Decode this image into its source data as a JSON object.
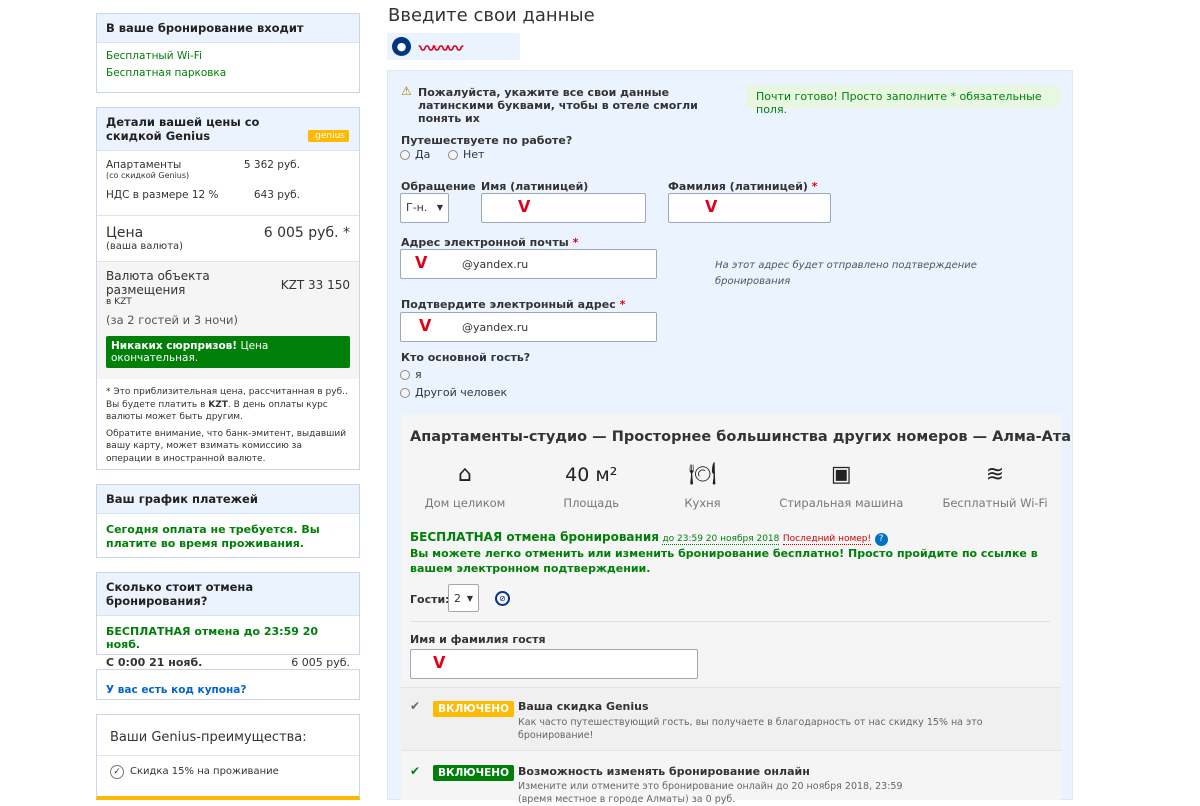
{
  "colors": {
    "accent": "#003580",
    "green": "#008009",
    "badge": "#feba02",
    "red": "#e0001a"
  },
  "left": {
    "includes": {
      "title": "В ваше бронирование входит",
      "items": [
        "Бесплатный Wi-Fi",
        "Бесплатная парковка"
      ]
    },
    "price": {
      "title": "Детали вашей цены со скидкой Genius",
      "genius_badge": ".genius",
      "apartments_label": "Апартаменты",
      "apartments_note": "(со скидкой Genius)",
      "apartments_value": "5 362 руб.",
      "vat_label": "НДС в размере 12 %",
      "vat_value": "643 руб.",
      "total_label": "Цена",
      "total_note": "(ваша валюта)",
      "total_value": "6 005 руб. *",
      "currency_label": "Валюта объекта размещения",
      "currency_note": "в KZT",
      "currency_value": "KZT 33 150",
      "guests_nights": "(за 2 гостей и 3 ночи)",
      "no_surprises_bold": "Никаких сюрпризов!",
      "no_surprises_rest": "Цена окончательная.",
      "note1_a": "* Это приблизительная цена, рассчитанная в руб.. Вы будете платить в ",
      "note1_bold": "KZT",
      "note1_b": ". В день оплаты курс валюты может быть другим.",
      "note2": "Обратите внимание, что банк-эмитент, выдавший вашу карту, может взимать комиссию за операции в иностранной валюте."
    },
    "payments": {
      "title": "Ваш график платежей",
      "text": "Сегодня оплата не требуется. Вы платите во время проживания."
    },
    "cancel": {
      "title": "Сколько стоит отмена бронирования?",
      "free_text": "БЕСПЛАТНАЯ отмена до 23:59 20 нояб.",
      "from_label": "С 0:00 21 нояб.",
      "from_value": "6 005 руб."
    },
    "coupon": {
      "link": "У вас есть код купона?"
    },
    "genius": {
      "title": "Ваши Genius-преимущества:",
      "item": "Скидка 15% на проживание"
    }
  },
  "form": {
    "heading": "Введите свои данные",
    "user_scribble": "〰〰〰",
    "warning_text": "Пожалуйста, укажите все свои данные латинскими буквами, чтобы в отеле смогли понять их",
    "almost_done": "Почти готово! Просто заполните * обязательные поля.",
    "business_q": "Путешествуете по работе?",
    "yes": "Да",
    "no": "Нет",
    "salutation_label": "Обращение",
    "salutation_value": "Г-н.",
    "first_name_label": "Имя (латиницей)",
    "first_name_value": "ᐯ",
    "last_name_label": "Фамилия (латиницей)",
    "last_name_value": "ᐯ",
    "required_mark": "*",
    "email_label": "Адрес электронной почты",
    "email_scribble": "ᐯ",
    "email_value": "@yandex.ru",
    "email_note": "На этот адрес будет отправлено подтверждение бронирования",
    "email_confirm_label": "Подтвердите электронный адрес",
    "email_confirm_scribble": "ᐯ",
    "email_confirm_value": "@yandex.ru",
    "main_guest_q": "Кто основной гость?",
    "me": "я",
    "other": "Другой человек"
  },
  "room": {
    "title": "Апартаменты-студио — Просторнее большинства других номеров — Алма-Ата",
    "features": [
      {
        "icon": "house-icon",
        "glyph": "⌂",
        "label": "Дом целиком"
      },
      {
        "icon": "area-icon",
        "glyph": "40 м²",
        "label": "Площадь"
      },
      {
        "icon": "kitchen-icon",
        "glyph": "🍽",
        "label": "Кухня"
      },
      {
        "icon": "washing-machine-icon",
        "glyph": "▣",
        "label": "Стиральная машина"
      },
      {
        "icon": "wifi-icon",
        "glyph": "≋",
        "label": "Бесплатный Wi-Fi"
      }
    ],
    "free_cancel_title": "БЕСПЛАТНАЯ отмена бронирования",
    "free_cancel_date": "до 23:59 20 ноября 2018",
    "last_room": "Последний номер!",
    "free_cancel_text": "Вы можете легко отменить или изменить бронирование бесплатно! Просто пройдите по ссылке в вашем электронном подтверждении.",
    "guests_label": "Гости:",
    "guests_value": "2",
    "guest_name_label": "Имя и фамилия гостя",
    "guest_name_scribble": "ᐯ",
    "genius_badge": "ВКЛЮЧЕНО",
    "genius_title": "Ваша скидка Genius",
    "genius_text": "Как часто путешествующий гость, вы получаете в благодарность от нас скидку 15% на это бронирование!",
    "change_badge": "ВКЛЮЧЕНО",
    "change_title": "Возможность изменять бронирование онлайн",
    "change_text": "Измените или отмените это бронирование онлайн до 20 ноября 2018, 23:59 (время местное в городе Алматы) за 0 руб."
  }
}
